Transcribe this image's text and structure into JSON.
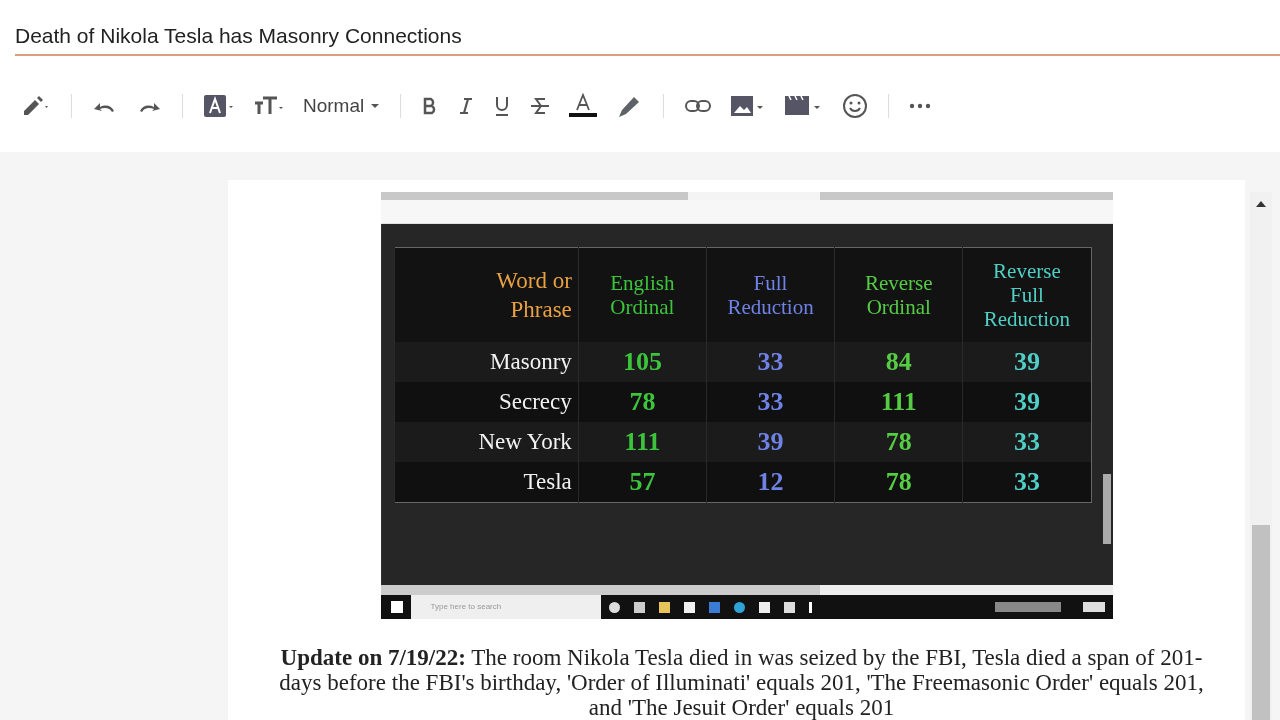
{
  "post_title": {
    "value": "Death of Nikola Tesla has Masonry Connections"
  },
  "toolbar": {
    "paragraph_style": "Normal"
  },
  "embedded_screenshot": {
    "taskbar_search": "Type here to search",
    "table": {
      "columns": [
        {
          "label": "Word or Phrase",
          "color": "#e8a040"
        },
        {
          "label": "English Ordinal",
          "color": "#3cc43c"
        },
        {
          "label": "Full Reduction",
          "color": "#6f82e6"
        },
        {
          "label": "Reverse Ordinal",
          "color": "#55cc44"
        },
        {
          "label": "Reverse Full Reduction",
          "color": "#4fcfc6"
        }
      ],
      "rows": [
        [
          "Masonry",
          "105",
          "33",
          "84",
          "39"
        ],
        [
          "Secrecy",
          "78",
          "33",
          "111",
          "39"
        ],
        [
          "New York",
          "111",
          "39",
          "78",
          "33"
        ],
        [
          "Tesla",
          "57",
          "12",
          "78",
          "33"
        ]
      ]
    }
  },
  "update_note": "**Update on 7/19/22:** The room Nikola Tesla died in was seized by the FBI, Tesla died a span of 201-days before the FBI's birthday, 'Order of Illuminati' equals 201, 'The Freemasonic Order' equals 201, and 'The Jesuit Order' equals 201"
}
